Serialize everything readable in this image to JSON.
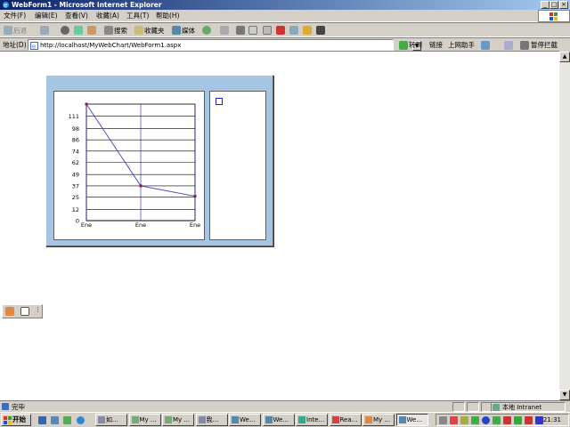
{
  "window": {
    "title": "WebForm1 - Microsoft Internet Explorer"
  },
  "menu": [
    "文件(F)",
    "编辑(E)",
    "查看(V)",
    "收藏(A)",
    "工具(T)",
    "帮助(H)"
  ],
  "toolbar": {
    "back": "后退",
    "search": "搜索",
    "favorites": "收藏夹",
    "media": "媒体"
  },
  "address": {
    "label": "地址(D)",
    "url": "http://localhost/MyWebChart/WebForm1.aspx",
    "go": "转到",
    "links": "链接",
    "helper": "上网助手",
    "block": "暂停拦截"
  },
  "chart_data": {
    "type": "line",
    "categories": [
      "Ene",
      "Ene",
      "Ene"
    ],
    "y_ticks": [
      0,
      12,
      25,
      37,
      49,
      62,
      74,
      86,
      98,
      111
    ],
    "ylim": [
      0,
      124
    ],
    "x": [
      1,
      2,
      3
    ],
    "series": [
      {
        "values": [
          124,
          37,
          26
        ],
        "color": "#4040c0"
      }
    ],
    "grid": true,
    "legend": "right"
  },
  "status": {
    "text": "完毕",
    "zone": "本地 Intranet"
  },
  "taskbar": {
    "start": "开始",
    "tasks": [
      "如...",
      "My ...",
      "My ...",
      "我...",
      "We...",
      "We...",
      "Inte...",
      "Rea...",
      "My ...",
      "We..."
    ],
    "clock": "21:31"
  }
}
